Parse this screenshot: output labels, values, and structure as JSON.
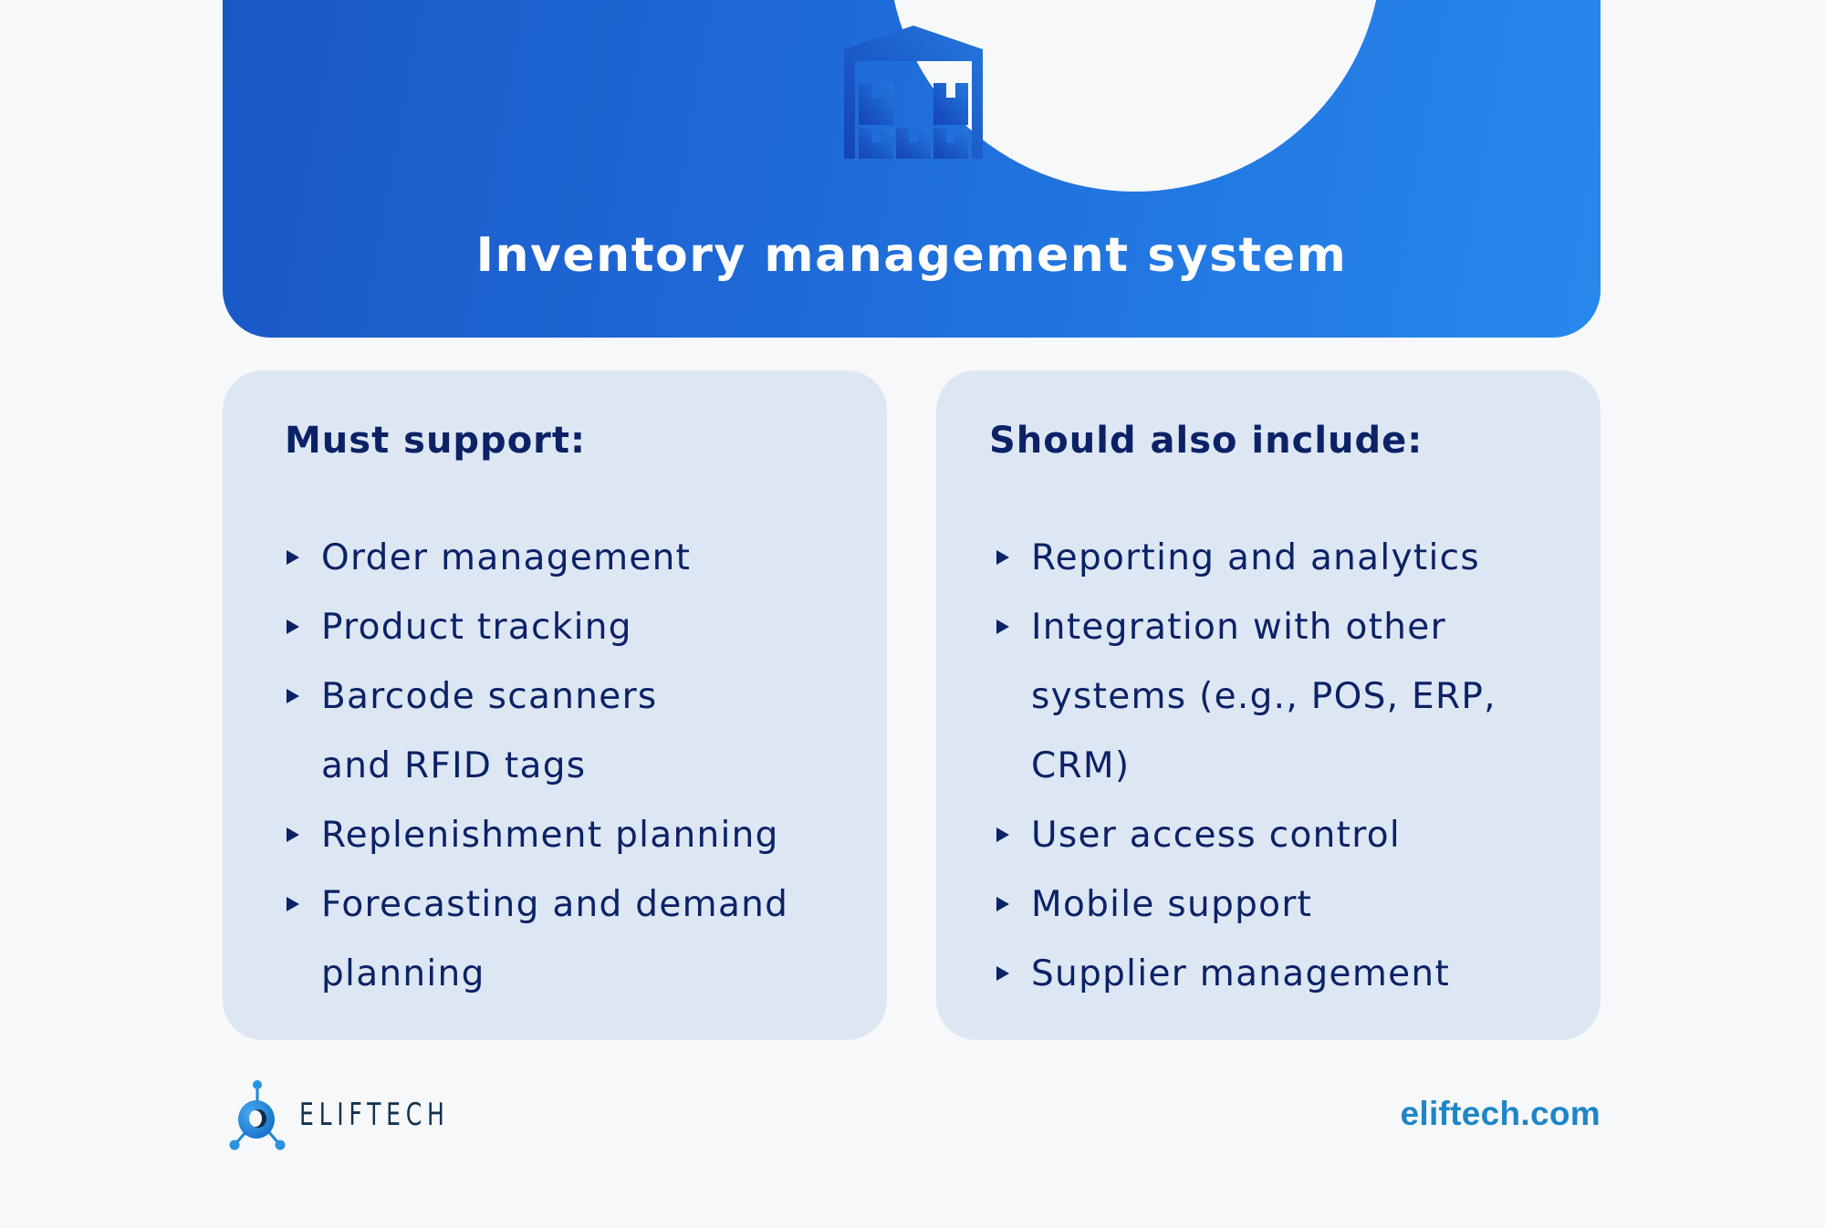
{
  "header": {
    "title": "Inventory management system",
    "icon": "warehouse-icon"
  },
  "cards": [
    {
      "heading": "Must support:",
      "items": [
        "Order management",
        "Product tracking",
        "Barcode scanners and RFID tags",
        "Replenishment planning",
        "Forecasting and demand planning"
      ]
    },
    {
      "heading": "Should also include:",
      "items": [
        "Reporting and analytics",
        "Integration with other systems (e.g., POS, ERP, CRM)",
        "User access control",
        "Mobile support",
        "Supplier management"
      ]
    }
  ],
  "footer": {
    "brand": "ELIFTECH",
    "url": "eliftech.com"
  },
  "colors": {
    "banner_start": "#1a57c6",
    "banner_end": "#2788ed",
    "card_bg": "#dde7f4",
    "text_dark": "#0c2266",
    "url": "#1e86c6",
    "page_bg": "#f7f8fa"
  }
}
